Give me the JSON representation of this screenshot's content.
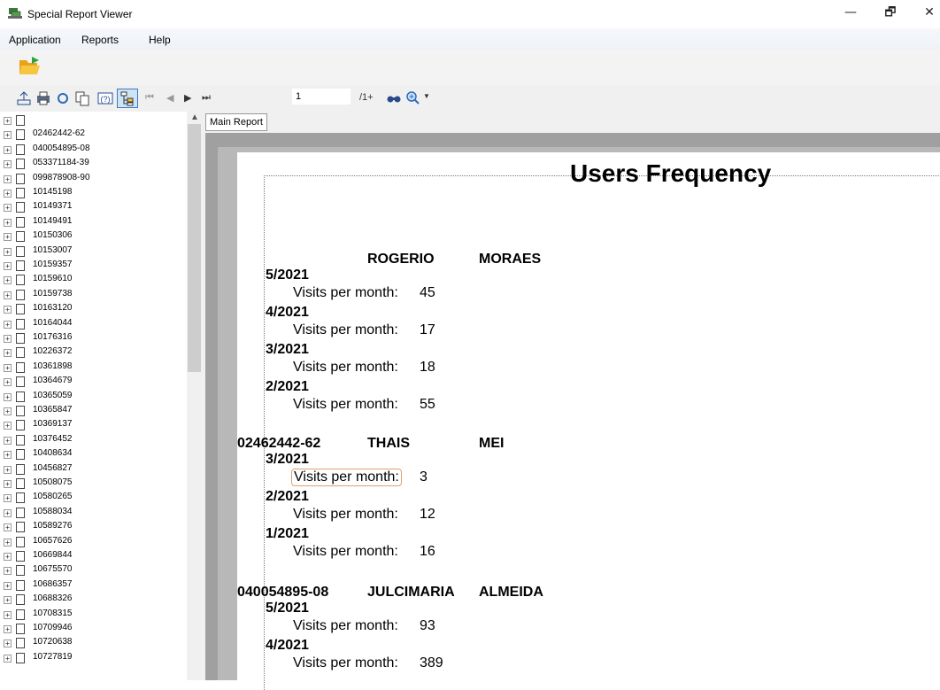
{
  "window": {
    "title": "Special Report Viewer",
    "minimize": "—",
    "restore": "🗗",
    "close": "✕"
  },
  "menu": [
    "Application",
    "Reports",
    "Help"
  ],
  "nav": {
    "page_value": "1",
    "page_total": "/1+"
  },
  "tab": "Main Report",
  "tree_items": [
    "",
    "02462442-62",
    "040054895-08",
    "053371184-39",
    "099878908-90",
    "10145198",
    "10149371",
    "10149491",
    "10150306",
    "10153007",
    "10159357",
    "10159610",
    "10159738",
    "10163120",
    "10164044",
    "10176316",
    "10226372",
    "10361898",
    "10364679",
    "10365059",
    "10365847",
    "10369137",
    "10376452",
    "10408634",
    "10456827",
    "10508075",
    "10580265",
    "10588034",
    "10589276",
    "10657626",
    "10669844",
    "10675570",
    "10686357",
    "10688326",
    "10708315",
    "10709946",
    "10720638",
    "10727819"
  ],
  "report": {
    "title": "Users Frequency",
    "visits_label": "Visits per month:",
    "groups": [
      {
        "id": "",
        "first": "ROGERIO",
        "last": "MORAES",
        "entries": [
          {
            "month": "5/2021",
            "visits": "45"
          },
          {
            "month": "4/2021",
            "visits": "17"
          },
          {
            "month": "3/2021",
            "visits": "18"
          },
          {
            "month": "2/2021",
            "visits": "55"
          }
        ]
      },
      {
        "id": "02462442-62",
        "first": "THAIS",
        "last": "MEI",
        "entries": [
          {
            "month": "3/2021",
            "visits": "3"
          },
          {
            "month": "2/2021",
            "visits": "12"
          },
          {
            "month": "1/2021",
            "visits": "16"
          }
        ]
      },
      {
        "id": "040054895-08",
        "first": "JULCIMARIA",
        "last": "ALMEIDA",
        "entries": [
          {
            "month": "5/2021",
            "visits": "93"
          },
          {
            "month": "4/2021",
            "visits": "389"
          }
        ]
      }
    ]
  }
}
